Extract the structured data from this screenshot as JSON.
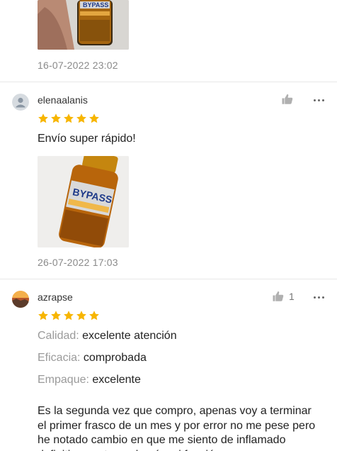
{
  "reviews": [
    {
      "date": "16-07-2022 23:02"
    },
    {
      "username": "elenaalanis",
      "rating": 5,
      "text": "Envío super rápido!",
      "date": "26-07-2022 17:03",
      "photo_label": "BYPASS"
    },
    {
      "username": "azrapse",
      "rating": 5,
      "like_count": "1",
      "attributes": [
        {
          "key": "Calidad:",
          "value": "excelente atención"
        },
        {
          "key": "Eficacia:",
          "value": "comprobada"
        },
        {
          "key": "Empaque:",
          "value": "excelente"
        }
      ],
      "body": "Es la segunda vez que compro, apenas voy a terminar el primer frasco de un mes y por error no me pese pero he notado cambio en que me siento de inflamado definitivamente y además mi función"
    }
  ],
  "top_photo_label": "BYPASS",
  "colors": {
    "star": "#f7b500",
    "divider": "#e8e8e8",
    "muted": "#8a8a8a"
  },
  "icons": {
    "like": "thumbs-up-icon",
    "more": "more-horizontal-icon",
    "avatar_default": "user-avatar-icon"
  }
}
